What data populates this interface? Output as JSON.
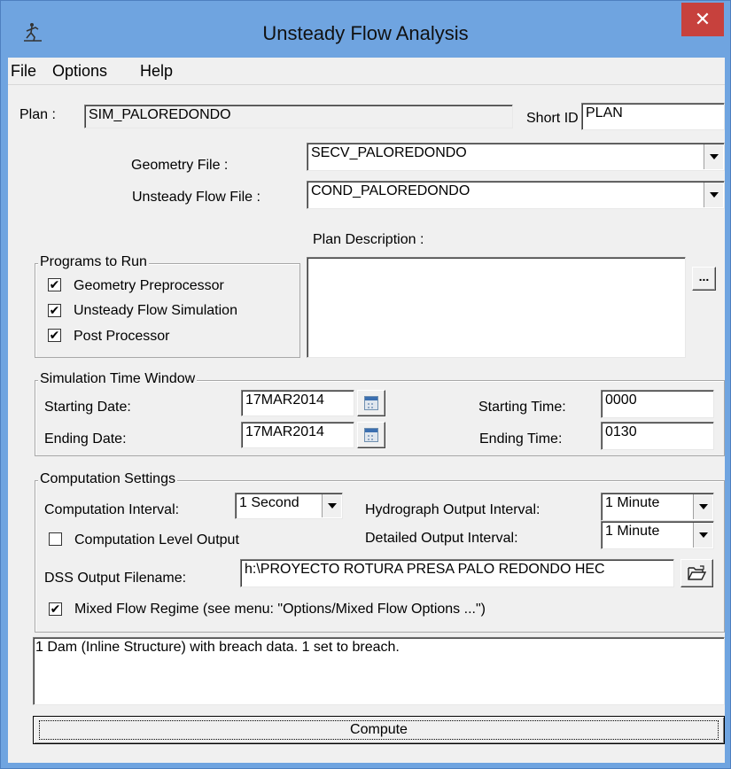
{
  "window": {
    "title": "Unsteady Flow Analysis",
    "close_symbol": "✕"
  },
  "menu": {
    "file": "File",
    "options": "Options",
    "help": "Help"
  },
  "plan": {
    "label": "Plan :",
    "value": "SIM_PALOREDONDO",
    "short_id_label": "Short ID",
    "short_id_value": "PLAN"
  },
  "geometry": {
    "label": "Geometry File :",
    "value": "SECV_PALOREDONDO"
  },
  "unsteady": {
    "label": "Unsteady Flow File :",
    "value": "COND_PALOREDONDO"
  },
  "description": {
    "label": "Plan Description :",
    "value": "",
    "button_label": "..."
  },
  "programs": {
    "title": "Programs to Run",
    "items": [
      {
        "label": "Geometry Preprocessor",
        "checked": true
      },
      {
        "label": "Unsteady Flow Simulation",
        "checked": true
      },
      {
        "label": "Post Processor",
        "checked": true
      }
    ]
  },
  "time_window": {
    "title": "Simulation Time Window",
    "start_date_label": "Starting Date:",
    "start_date": "17MAR2014",
    "end_date_label": "Ending Date:",
    "end_date": "17MAR2014",
    "start_time_label": "Starting Time:",
    "start_time": "0000",
    "end_time_label": "Ending Time:",
    "end_time": "0130"
  },
  "computation": {
    "title": "Computation Settings",
    "interval_label": "Computation Interval:",
    "interval_value": "1 Second",
    "hydro_label": "Hydrograph Output Interval:",
    "hydro_value": "1 Minute",
    "level_output_label": "Computation Level Output",
    "level_output_checked": false,
    "detailed_label": "Detailed Output Interval:",
    "detailed_value": "1 Minute",
    "dss_label": "DSS Output Filename:",
    "dss_value": "h:\\PROYECTO ROTURA PRESA PALO REDONDO HEC",
    "mixed_label": "Mixed Flow Regime (see menu: \"Options/Mixed Flow Options ...\")",
    "mixed_checked": true
  },
  "messages": {
    "text": "1 Dam (Inline Structure) with breach data. 1 set to breach."
  },
  "compute_button": {
    "label": "Compute"
  },
  "icons": {
    "app": "hec-ras-runner-icon",
    "calendar": "calendar-icon",
    "folder": "open-folder-icon",
    "check": "✔"
  }
}
